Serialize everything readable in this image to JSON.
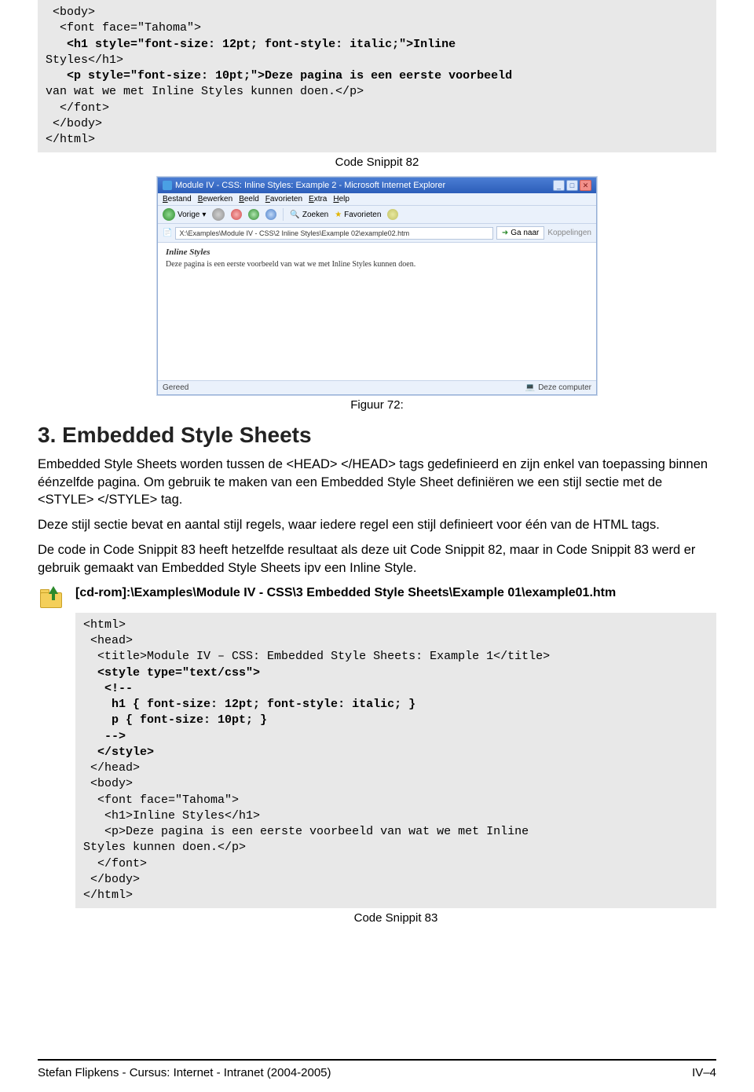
{
  "code_snippit_82": {
    "lines": [
      " <body>",
      "  <font face=\"Tahoma\">",
      "   <h1 style=\"font-size: 12pt; font-style: italic;\">Inline",
      "Styles</h1>",
      "   <p style=\"font-size: 10pt;\">Deze pagina is een eerste voorbeeld",
      "van wat we met Inline Styles kunnen doen.</p>",
      "  </font>",
      " </body>",
      "</html>"
    ],
    "bold_lines": [
      2,
      4
    ],
    "caption": "Code Snippit 82"
  },
  "ie_window": {
    "title": "Module IV - CSS: Inline Styles: Example 2 - Microsoft Internet Explorer",
    "menu": [
      "Bestand",
      "Bewerken",
      "Beeld",
      "Favorieten",
      "Extra",
      "Help"
    ],
    "toolbar": {
      "back": "Vorige",
      "search": "Zoeken",
      "favorites": "Favorieten"
    },
    "address": "X:\\Examples\\Module IV - CSS\\2 Inline Styles\\Example 02\\example02.htm",
    "go": "Ga naar",
    "links": "Koppelingen",
    "content_heading": "Inline Styles",
    "content_body": "Deze pagina is een eerste voorbeeld van wat we met Inline Styles kunnen doen.",
    "status_left": "Gereed",
    "status_right": "Deze computer"
  },
  "figure_caption": "Figuur 72:",
  "section_heading": "3. Embedded Style Sheets",
  "paragraphs": {
    "p1": "Embedded Style Sheets worden tussen de <HEAD> </HEAD> tags gedefinieerd en zijn enkel van toepassing binnen éénzelfde pagina. Om gebruik te maken van een Embedded Style Sheet definiëren we een stijl sectie met de <STYLE> </STYLE> tag.",
    "p2": "Deze stijl sectie bevat en aantal stijl regels, waar iedere regel een stijl definieert voor één van de HTML tags.",
    "p3": "De code in Code Snippit 83 heeft hetzelfde resultaat als deze uit Code Snippit 82, maar in Code Snippit 83 werd er gebruik gemaakt van Embedded Style Sheets ipv een Inline Style."
  },
  "example": {
    "header": "[cd-rom]:\\Examples\\Module IV - CSS\\3 Embedded Style Sheets\\Example 01\\example01.htm",
    "lines": [
      "<html>",
      " <head>",
      "  <title>Module IV – CSS: Embedded Style Sheets: Example 1</title>",
      "  <style type=\"text/css\">",
      "   <!--",
      "    h1 { font-size: 12pt; font-style: italic; }",
      "    p { font-size: 10pt; }",
      "   -->",
      "  </style>",
      " </head>",
      " <body>",
      "  <font face=\"Tahoma\">",
      "   <h1>Inline Styles</h1>",
      "   <p>Deze pagina is een eerste voorbeeld van wat we met Inline",
      "Styles kunnen doen.</p>",
      "  </font>",
      " </body>",
      "</html>"
    ],
    "bold_lines": [
      3,
      4,
      5,
      6,
      7,
      8
    ],
    "caption": "Code Snippit 83"
  },
  "footer": {
    "left": "Stefan Flipkens - Cursus:  Internet - Intranet (2004-2005)",
    "right": "IV–4"
  }
}
